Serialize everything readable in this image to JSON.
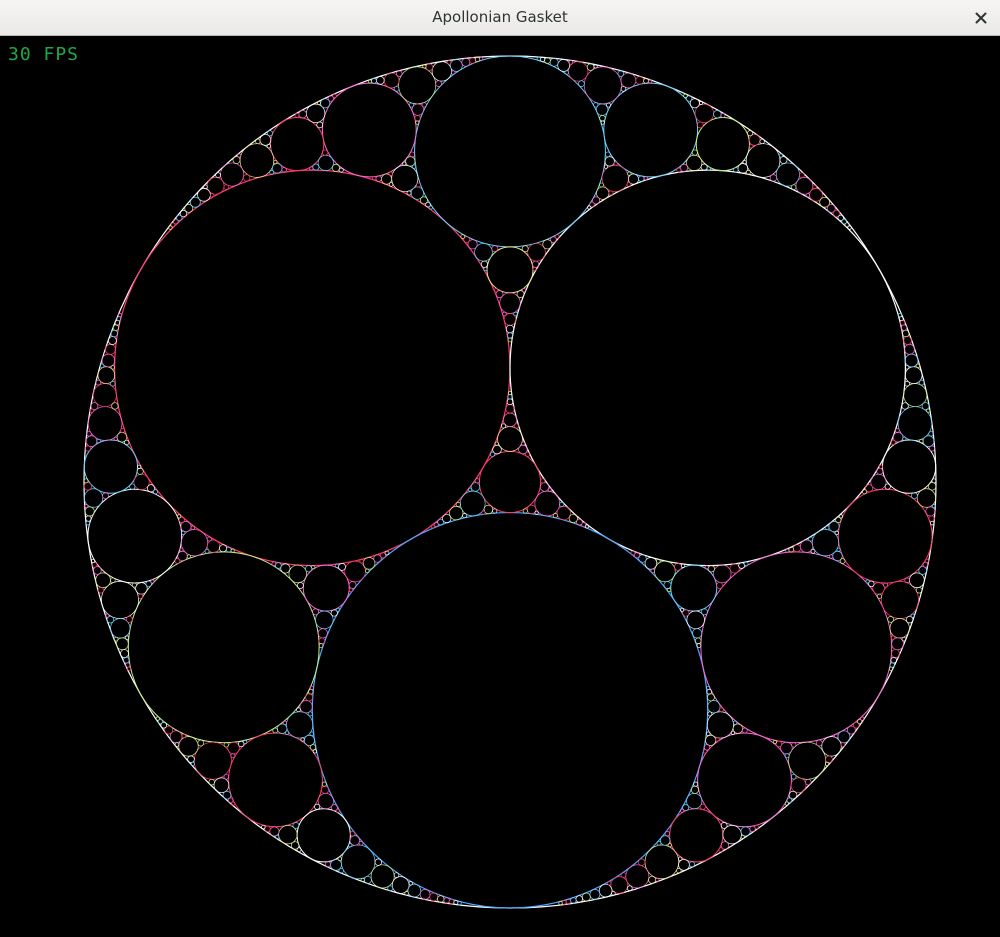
{
  "window": {
    "title": "Apollonian Gasket",
    "close_icon": "close-icon"
  },
  "hud": {
    "fps_text": "30 FPS",
    "fps_color": "#1fa84a"
  },
  "gasket": {
    "background_color": "#000000",
    "outer_circle_color": "#ffffff",
    "stroke_palette": [
      "#ffffff",
      "#ff3b6b",
      "#c8f08a",
      "#ff6ad5",
      "#6ad0ff",
      "#f0e68c"
    ],
    "highlight_colors": {
      "upper_left": "#ff3b6b",
      "upper_right": "#ffffff",
      "bottom": "#4fa8ff"
    },
    "recursion_depth": 7
  }
}
